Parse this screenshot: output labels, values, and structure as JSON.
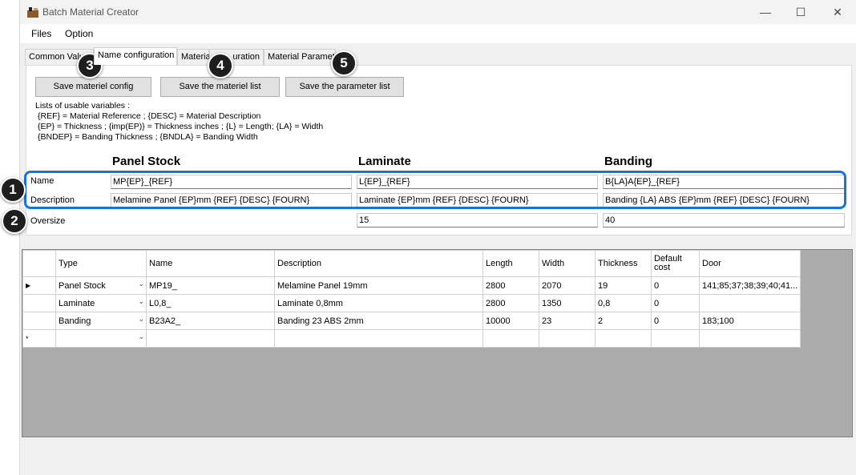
{
  "window": {
    "title": "Batch Material Creator",
    "minimize": "—",
    "maximize": "☐",
    "close": "✕"
  },
  "menu": {
    "items": [
      "Files",
      "Option"
    ]
  },
  "tabs": [
    "Common Valu",
    "Name configuration",
    "Material",
    "uration",
    "Material Paramet"
  ],
  "buttons": {
    "save_config": "Save materiel config",
    "save_list": "Save the materiel list",
    "save_params": "Save the parameter list"
  },
  "variables": [
    "Lists of usable variables :",
    "{REF} = Material Reference ; {DESC} = Material Description",
    "{EP} = Thickness ; {imp(EP)} = Thickness inches ; {L} = Length; {LA} = Width",
    "{BNDEP} = Banding Thickness ; {BNDLA} = Banding Width"
  ],
  "columns": [
    "Panel Stock",
    "Laminate",
    "Banding"
  ],
  "rows": {
    "name_label": "Name",
    "desc_label": "Description",
    "oversize_label": "Oversize"
  },
  "fields": {
    "name": [
      "MP{EP}_{REF}",
      "L{EP}_{REF}",
      "B{LA}A{EP}_{REF}"
    ],
    "description": [
      "Melamine Panel {EP}mm {REF} {DESC} {FOURN}",
      "Laminate {EP}mm {REF} {DESC} {FOURN}",
      "Banding {LA} ABS {EP}mm {REF} {DESC} {FOURN}"
    ],
    "oversize": [
      "15",
      "40"
    ]
  },
  "callouts": [
    "1",
    "2",
    "3",
    "4",
    "5"
  ],
  "grid": {
    "headers": [
      "Type",
      "Name",
      "Description",
      "Length",
      "Width",
      "Thickness",
      "Default cost",
      "Door"
    ],
    "rows": [
      {
        "marker": "▶",
        "type": "Panel Stock",
        "name": "MP19_",
        "description": "Melamine Panel 19mm",
        "length": "2800",
        "width": "2070",
        "thickness": "19",
        "cost": "0",
        "door": "141;85;37;38;39;40;41..."
      },
      {
        "marker": "",
        "type": "Laminate",
        "name": "L0,8_",
        "description": "Laminate 0,8mm",
        "length": "2800",
        "width": "1350",
        "thickness": "0,8",
        "cost": "0",
        "door": ""
      },
      {
        "marker": "",
        "type": "Banding",
        "name": "B23A2_",
        "description": "Banding 23 ABS 2mm",
        "length": "10000",
        "width": "23",
        "thickness": "2",
        "cost": "0",
        "door": "183;100"
      },
      {
        "marker": "*",
        "type": "",
        "name": "",
        "description": "",
        "length": "",
        "width": "",
        "thickness": "",
        "cost": "",
        "door": ""
      }
    ]
  },
  "colors": {
    "highlight": "#1a73d9",
    "callout": "#1e1e1e"
  }
}
